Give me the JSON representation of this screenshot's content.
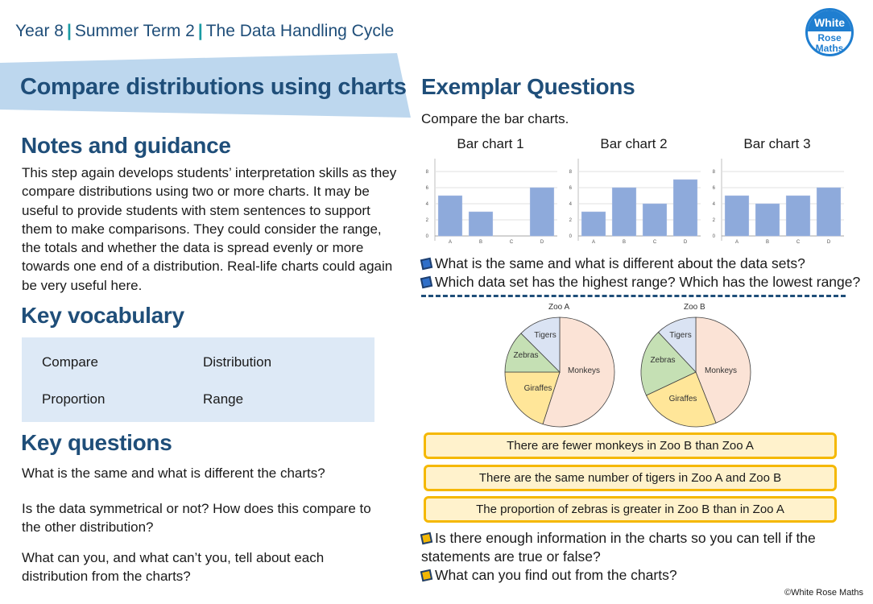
{
  "header": {
    "breadcrumb": [
      "Year 8",
      "Summer Term 2",
      "The Data Handling Cycle"
    ],
    "separator": "|",
    "logo": {
      "line1": "White",
      "line2": "Rose",
      "line3": "Maths"
    }
  },
  "page_title": "Compare distributions using charts",
  "notes": {
    "heading": "Notes and guidance",
    "lines": [
      "This step again develops students’ interpretation skills as they",
      "compare distributions using two or more charts. It may be",
      "useful to provide students with stem sentences to support",
      "them to make comparisons. They could consider the range,",
      "the totals and whether the data is spread evenly or more",
      "towards one end of a distribution. Real-life charts could again",
      "be very useful here."
    ]
  },
  "vocabulary": {
    "heading": "Key vocabulary",
    "items": [
      "Compare",
      "Distribution",
      "Proportion",
      "Range"
    ]
  },
  "key_questions": {
    "heading": "Key questions",
    "items": [
      [
        "What is the same and what is different the charts?"
      ],
      [
        "Is the data symmetrical or not? How does this compare to",
        "the other distribution?"
      ],
      [
        "What can you, and what can’t you, tell about each",
        "distribution from the charts?"
      ]
    ]
  },
  "exemplar": {
    "heading": "Exemplar Questions",
    "intro": "Compare the bar charts.",
    "bar_questions": [
      "What is the same and what is different about the data sets?",
      "Which data set has the highest range? Which has the lowest range?"
    ],
    "statements": [
      "There are fewer monkeys in Zoo B than Zoo A",
      "There are the same number of tigers in Zoo A and Zoo B",
      "The proportion of zebras is greater in Zoo B than in Zoo A"
    ],
    "pie_questions": [
      [
        "Is there enough information in the charts so you can tell if the",
        "statements are true or false?"
      ],
      [
        "What can you find out from the charts?"
      ]
    ]
  },
  "colors": {
    "heading": "#1f4e79",
    "accent_teal": "#1a9ba3",
    "band": "#bdd7ee",
    "vocab_bg": "#dde9f6",
    "bar": "#8eaadb",
    "statement_border": "#f5b800",
    "statement_bg": "#fff2cc",
    "monkeys": "#fbe3d6",
    "giraffes": "#ffe699",
    "zebras": "#c5e0b4",
    "tigers": "#dae3f3"
  },
  "chart_data": [
    {
      "type": "bar",
      "title": "Bar chart 1",
      "categories": [
        "A",
        "B",
        "C",
        "D"
      ],
      "values": [
        5,
        3,
        0,
        6
      ],
      "yticks": [
        0,
        2,
        4,
        6,
        8
      ],
      "ylim": [
        0,
        9
      ],
      "grid": true,
      "xlabel": "",
      "ylabel": ""
    },
    {
      "type": "bar",
      "title": "Bar chart 2",
      "categories": [
        "A",
        "B",
        "C",
        "D"
      ],
      "values": [
        3,
        6,
        4,
        7
      ],
      "yticks": [
        0,
        2,
        4,
        6,
        8
      ],
      "ylim": [
        0,
        9
      ],
      "grid": true,
      "xlabel": "",
      "ylabel": ""
    },
    {
      "type": "bar",
      "title": "Bar chart 3",
      "categories": [
        "A",
        "B",
        "C",
        "D"
      ],
      "values": [
        5,
        4,
        5,
        6
      ],
      "yticks": [
        0,
        2,
        4,
        6,
        8
      ],
      "ylim": [
        0,
        9
      ],
      "grid": true,
      "xlabel": "",
      "ylabel": ""
    },
    {
      "type": "pie",
      "title": "Zoo A",
      "labels": [
        "Monkeys",
        "Giraffes",
        "Zebras",
        "Tigers"
      ],
      "values": [
        55,
        20,
        12.5,
        12.5
      ],
      "unit": "percent (estimated)"
    },
    {
      "type": "pie",
      "title": "Zoo B",
      "labels": [
        "Monkeys",
        "Giraffes",
        "Zebras",
        "Tigers"
      ],
      "values": [
        44,
        24,
        20,
        12
      ],
      "unit": "percent (estimated)"
    }
  ],
  "copyright": "©White Rose Maths"
}
